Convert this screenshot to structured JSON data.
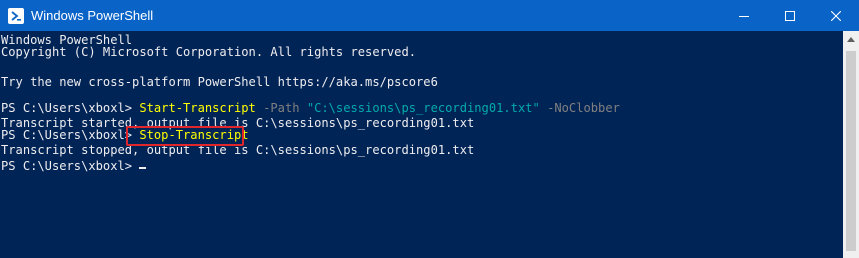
{
  "window": {
    "title": "Windows PowerShell",
    "icon": "powershell-icon",
    "controls": [
      "minimize-icon",
      "maximize-icon",
      "close-icon"
    ],
    "colors": {
      "titlebar": "#0a64c8",
      "console_bg": "#012456",
      "text": "#eeedf0",
      "command": "#ffff00",
      "parameter": "#808080",
      "string": "#00abab",
      "highlight_box": "#e0252b"
    }
  },
  "console": {
    "header": [
      "Windows PowerShell",
      "Copyright (C) Microsoft Corporation. All rights reserved.",
      "",
      "Try the new cross-platform PowerShell https://aka.ms/pscore6"
    ],
    "start_line": {
      "prompt": "PS C:\\Users\\xboxl> ",
      "command": "Start-Transcript",
      "param1": " -Path ",
      "path_string": "\"C:\\sessions\\ps_recording01.txt\"",
      "param2": " -NoClobber"
    },
    "started_output": "Transcript started, output file is C:\\sessions\\ps_recording01.txt",
    "stop_line": {
      "prompt": "PS C:\\Users\\xboxl> ",
      "command": "Stop-Transcript"
    },
    "stopped_output": "Transcript stopped, output file is C:\\sessions\\ps_recording01.txt",
    "final_prompt": "PS C:\\Users\\xboxl>"
  }
}
